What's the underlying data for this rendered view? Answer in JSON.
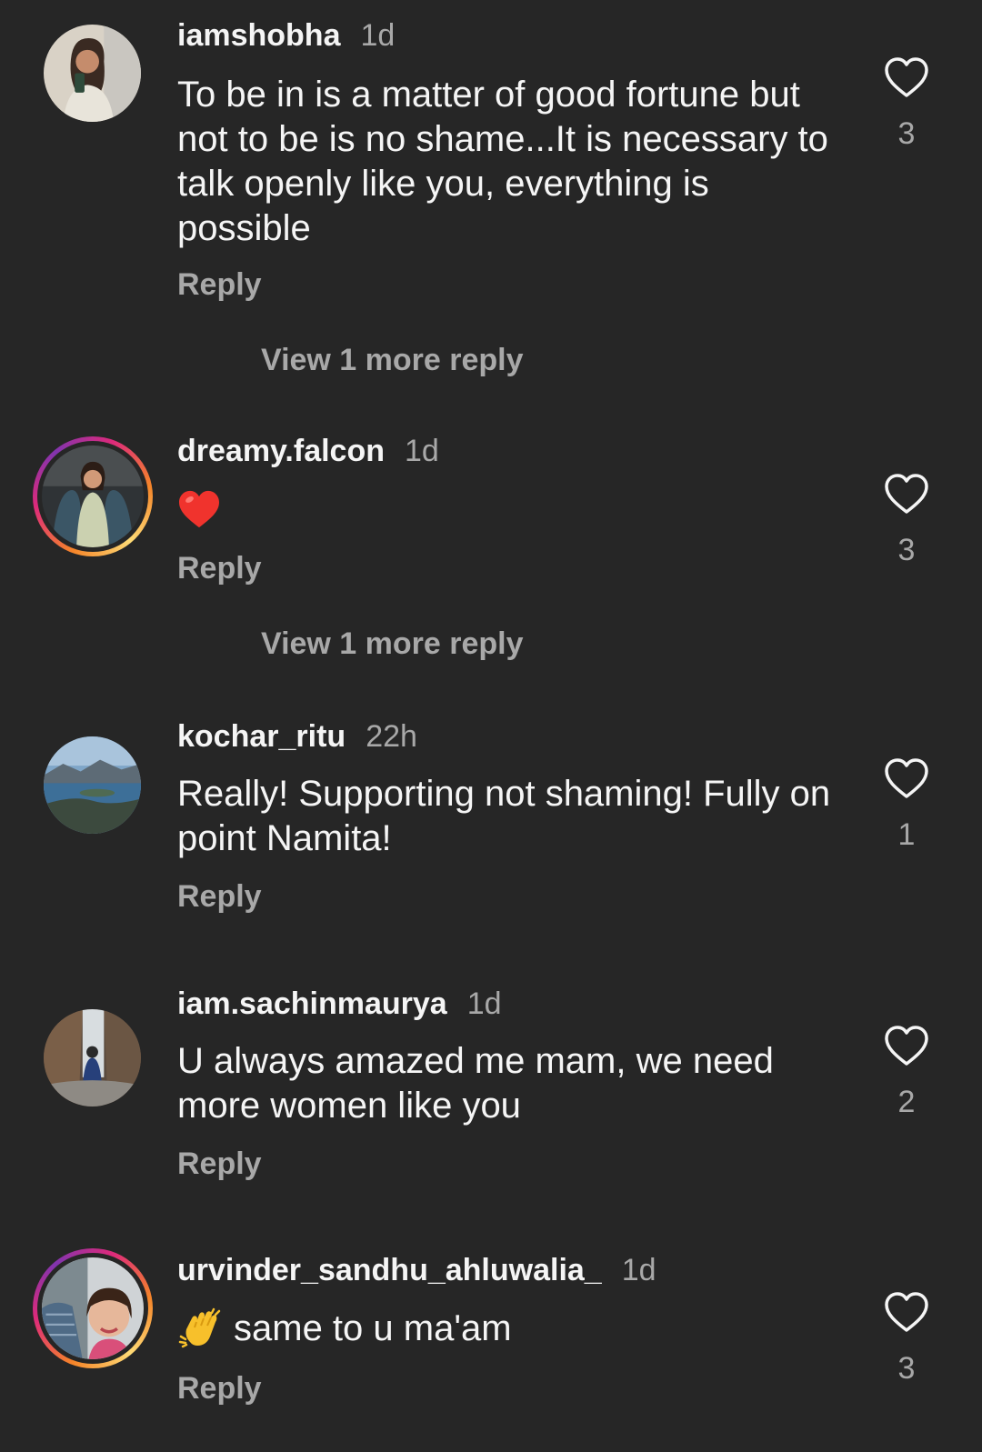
{
  "comments": [
    {
      "username": "iamshobha",
      "time": "1d",
      "text": "To be in is a matter of good fortune but not to be is no shame...It is necessary to talk openly like you, everything is possible",
      "reply_label": "Reply",
      "likes": "3",
      "more_replies": "View 1 more reply"
    },
    {
      "username": "dreamy.falcon",
      "time": "1d",
      "emoji": "red-heart",
      "reply_label": "Reply",
      "likes": "3",
      "more_replies": "View 1 more reply"
    },
    {
      "username": "kochar_ritu",
      "time": "22h",
      "text": "Really! Supporting not shaming! Fully on point Namita!",
      "reply_label": "Reply",
      "likes": "1"
    },
    {
      "username": "iam.sachinmaurya",
      "time": "1d",
      "text": "U always amazed me mam, we need more women like you",
      "reply_label": "Reply",
      "likes": "2"
    },
    {
      "username": "urvinder_sandhu_ahluwalia_",
      "time": "1d",
      "emoji": "clapping-hands",
      "text": "same to u ma'am",
      "reply_label": "Reply",
      "likes": "3"
    }
  ],
  "icons": {
    "like": "heart-outline-icon",
    "emoji_heart": "red-heart-emoji",
    "emoji_clap": "clapping-hands-emoji"
  },
  "colors": {
    "background": "#262626",
    "primary_text": "#f5f5f5",
    "secondary_text": "#a8a8a8",
    "story_ring": "#dd2a7b"
  }
}
